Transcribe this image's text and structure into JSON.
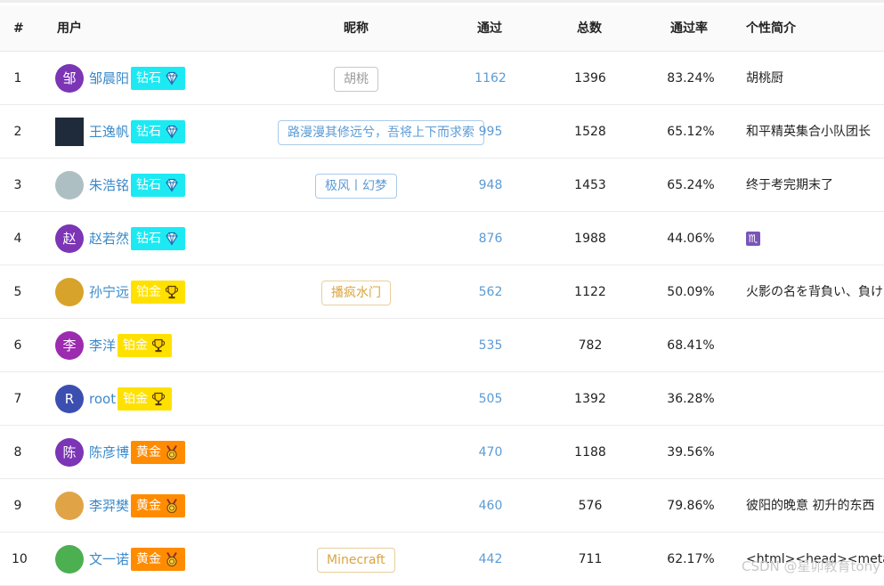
{
  "headers": {
    "rank": "#",
    "user": "用户",
    "nickname": "昵称",
    "passed": "通过",
    "total": "总数",
    "rate": "通过率",
    "bio": "个性简介"
  },
  "rows": [
    {
      "rank": "1",
      "avatar_text": "邹",
      "avatar_color": "#7b35b5",
      "username": "邹晨阳",
      "badge": "钻石",
      "badge_icon": "diamond-icon",
      "nickname": "胡桃",
      "nick_color": "#9a9a9a",
      "passed": "1162",
      "total": "1396",
      "rate": "83.24%",
      "bio": "胡桃厨"
    },
    {
      "rank": "2",
      "avatar_text": "",
      "avatar_color": "#1f2a3a",
      "username": "王逸帆",
      "badge": "钻石",
      "badge_icon": "diamond-icon",
      "nickname": "路漫漫其修远兮，吾将上下而求索",
      "nick_color": "#5b9bd5",
      "passed": "995",
      "total": "1528",
      "rate": "65.12%",
      "bio": "和平精英集合小队团长"
    },
    {
      "rank": "3",
      "avatar_text": "",
      "avatar_color": "#aebfc4",
      "username": "朱浩铭",
      "badge": "钻石",
      "badge_icon": "diamond-icon",
      "nickname": "极风丨幻梦",
      "nick_color": "#5b9bd5",
      "passed": "948",
      "total": "1453",
      "rate": "65.24%",
      "bio": "终于考完期末了"
    },
    {
      "rank": "4",
      "avatar_text": "赵",
      "avatar_color": "#7b35b5",
      "username": "赵若然",
      "badge": "钻石",
      "badge_icon": "diamond-icon",
      "nickname": "",
      "nick_color": "",
      "passed": "876",
      "total": "1988",
      "rate": "44.06%",
      "bio": "♏"
    },
    {
      "rank": "5",
      "avatar_text": "",
      "avatar_color": "#d7a32a",
      "username": "孙宁远",
      "badge": "铂金",
      "badge_icon": "trophy-icon",
      "nickname": "播疯水门",
      "nick_color": "#d9a441",
      "passed": "562",
      "total": "1122",
      "rate": "50.09%",
      "bio": "火影の名を背負い、負け"
    },
    {
      "rank": "6",
      "avatar_text": "李",
      "avatar_color": "#9c2bb0",
      "username": "李洋",
      "badge": "铂金",
      "badge_icon": "trophy-icon",
      "nickname": "",
      "nick_color": "",
      "passed": "535",
      "total": "782",
      "rate": "68.41%",
      "bio": ""
    },
    {
      "rank": "7",
      "avatar_text": "R",
      "avatar_color": "#3c4fb0",
      "username": "root",
      "badge": "铂金",
      "badge_icon": "trophy-icon",
      "nickname": "",
      "nick_color": "",
      "passed": "505",
      "total": "1392",
      "rate": "36.28%",
      "bio": ""
    },
    {
      "rank": "8",
      "avatar_text": "陈",
      "avatar_color": "#7b35b5",
      "username": "陈彦博",
      "badge": "黄金",
      "badge_icon": "medal-icon",
      "nickname": "",
      "nick_color": "",
      "passed": "470",
      "total": "1188",
      "rate": "39.56%",
      "bio": ""
    },
    {
      "rank": "9",
      "avatar_text": "",
      "avatar_color": "#e0a447",
      "username": "李羿樊",
      "badge": "黄金",
      "badge_icon": "medal-icon",
      "nickname": "",
      "nick_color": "",
      "passed": "460",
      "total": "576",
      "rate": "79.86%",
      "bio": "彼阳的晚意 初升的东西"
    },
    {
      "rank": "10",
      "avatar_text": "",
      "avatar_color": "#4caf50",
      "username": "文一诺",
      "badge": "黄金",
      "badge_icon": "medal-icon",
      "nickname": "Minecraft",
      "nick_color": "#d9a441",
      "passed": "442",
      "total": "711",
      "rate": "62.17%",
      "bio": "<html><head><meta"
    }
  ],
  "watermark": "CSDN @星卯教育tony"
}
